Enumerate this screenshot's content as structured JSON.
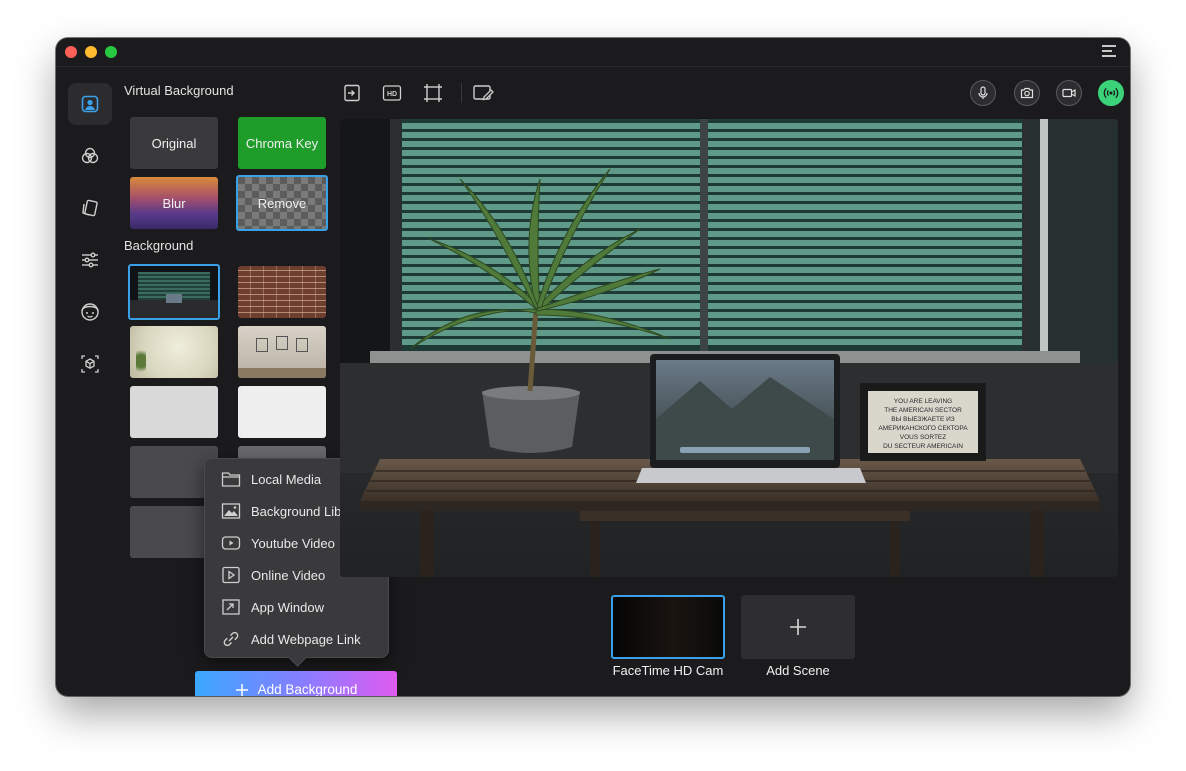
{
  "window": {
    "traffic_lights": {
      "close": "#fe5f57",
      "minimize": "#febc2e",
      "zoom": "#28c840"
    }
  },
  "sidebar": {
    "items": [
      {
        "icon": "portrait-icon",
        "active": true
      },
      {
        "icon": "filters-icon",
        "active": false
      },
      {
        "icon": "stickers-icon",
        "active": false
      },
      {
        "icon": "adjustments-icon",
        "active": false
      },
      {
        "icon": "avatar-icon",
        "active": false
      },
      {
        "icon": "3d-box-icon",
        "active": false
      }
    ]
  },
  "virtual_background": {
    "title": "Virtual Background",
    "options": [
      {
        "label": "Original"
      },
      {
        "label": "Chroma Key"
      },
      {
        "label": "Blur"
      },
      {
        "label": "Remove",
        "selected": true
      }
    ]
  },
  "background": {
    "title": "Background"
  },
  "add_menu": {
    "items": [
      {
        "label": "Local Media",
        "icon": "folder-icon"
      },
      {
        "label": "Background Library",
        "icon": "image-icon"
      },
      {
        "label": "Youtube Video",
        "icon": "youtube-icon"
      },
      {
        "label": "Online Video",
        "icon": "play-icon"
      },
      {
        "label": "App Window",
        "icon": "app-window-icon"
      },
      {
        "label": "Add Webpage Link",
        "icon": "link-icon"
      }
    ]
  },
  "add_background_button": {
    "label": "Add Background"
  },
  "scenes": [
    {
      "label": "FaceTime HD Cam",
      "selected": true
    },
    {
      "label": "Add Scene"
    }
  ],
  "preview": {
    "sign_text": [
      "YOU ARE LEAVING",
      "THE AMERICAN SECTOR",
      "ВЫ ВЫЕЗЖАЕТЕ ИЗ",
      "АМЕРИКАНСКОГО СЕКТОРА",
      "VOUS SORTEZ",
      "DU SECTEUR AMERICAIN"
    ]
  },
  "colors": {
    "accent": "#3aa0e8",
    "live": "#3bd37a",
    "chroma": "#1f9d2a"
  }
}
